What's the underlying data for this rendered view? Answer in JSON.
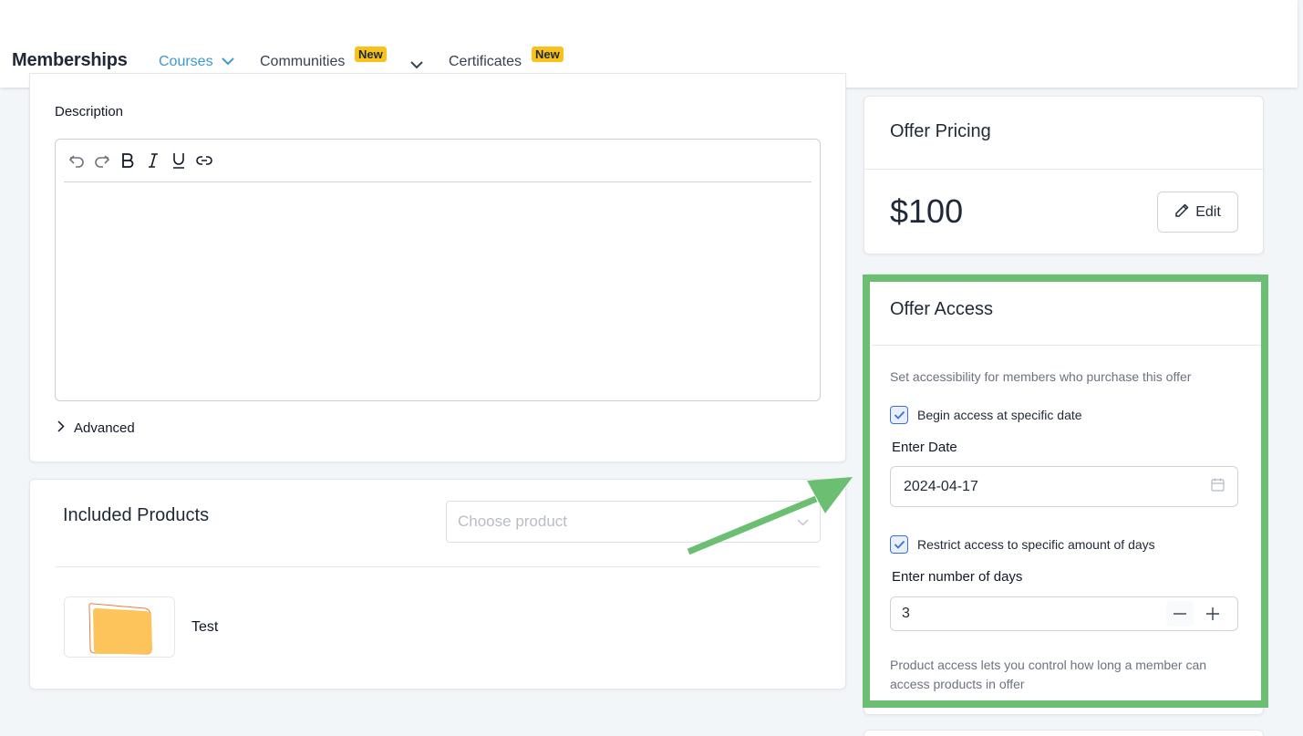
{
  "nav": {
    "brand": "Memberships",
    "tabs": [
      {
        "label": "Courses",
        "active": true
      },
      {
        "label": "Communities",
        "badge": "New"
      },
      {
        "label": "Certificates",
        "badge": "New"
      }
    ]
  },
  "description": {
    "label": "Description",
    "toolbar": [
      "undo-icon",
      "redo-icon",
      "bold-icon",
      "italic-icon",
      "underline-icon",
      "link-icon"
    ],
    "advanced_label": "Advanced"
  },
  "products": {
    "title": "Included Products",
    "select_placeholder": "Choose product",
    "items": [
      {
        "name": "Test"
      }
    ]
  },
  "pricing": {
    "title": "Offer Pricing",
    "price": "$100",
    "edit_label": "Edit"
  },
  "access": {
    "title": "Offer Access",
    "subtitle": "Set accessibility for members who purchase this offer",
    "begin_checkbox_label": "Begin access at specific date",
    "begin_checked": true,
    "date_label": "Enter Date",
    "date_value": "2024-04-17",
    "restrict_checkbox_label": "Restrict access to specific amount of days",
    "restrict_checked": true,
    "days_label": "Enter number of days",
    "days_value": "3",
    "help_text": "Product access lets you control how long a member can access products in offer"
  },
  "colors": {
    "accent": "#3b9ad2",
    "badge": "#f8c21b",
    "highlight": "#6cbf72"
  }
}
